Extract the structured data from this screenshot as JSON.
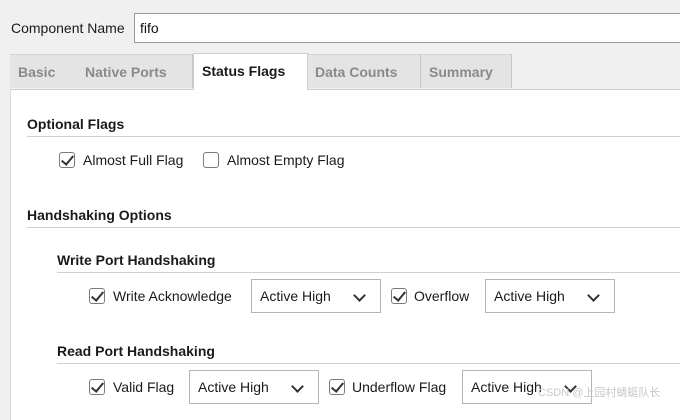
{
  "component_name": {
    "label": "Component Name",
    "value": "fifo"
  },
  "tabs": [
    {
      "label": "Basic",
      "active": false
    },
    {
      "label": "Native Ports",
      "active": false
    },
    {
      "label": "Status Flags",
      "active": true
    },
    {
      "label": "Data Counts",
      "active": false
    },
    {
      "label": "Summary",
      "active": false
    }
  ],
  "optional_flags": {
    "title": "Optional Flags",
    "almost_full": {
      "label": "Almost Full Flag",
      "checked": true
    },
    "almost_empty": {
      "label": "Almost Empty Flag",
      "checked": false
    }
  },
  "handshaking": {
    "title": "Handshaking Options",
    "write": {
      "title": "Write Port Handshaking",
      "ack": {
        "label": "Write Acknowledge",
        "checked": true,
        "select": "Active High"
      },
      "overflow": {
        "label": "Overflow",
        "checked": true,
        "select": "Active High"
      }
    },
    "read": {
      "title": "Read Port Handshaking",
      "valid": {
        "label": "Valid Flag",
        "checked": true,
        "select": "Active High"
      },
      "underflow": {
        "label": "Underflow Flag",
        "checked": true,
        "select": "Active High"
      }
    }
  },
  "watermark": "CSDN @上园村蜻蜓队长"
}
